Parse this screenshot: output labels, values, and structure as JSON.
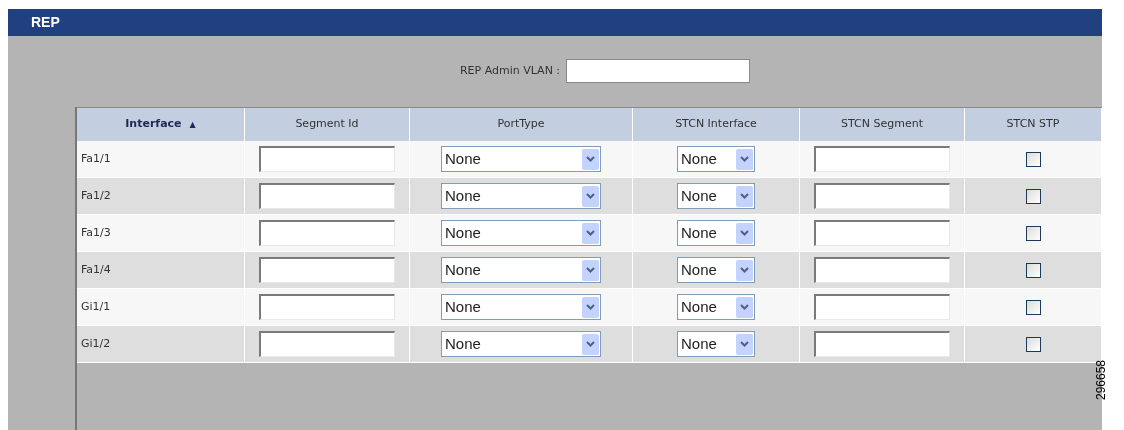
{
  "header": {
    "title": "REP"
  },
  "admin_vlan": {
    "label": "REP Admin VLAN :"
  },
  "table": {
    "columns": [
      {
        "label": "Interface",
        "sorted": true,
        "sort_icon": "▲"
      },
      {
        "label": "Segment Id",
        "sorted": false
      },
      {
        "label": "PortType",
        "sorted": false
      },
      {
        "label": "STCN Interface",
        "sorted": false
      },
      {
        "label": "STCN Segment",
        "sorted": false
      },
      {
        "label": "STCN STP",
        "sorted": false
      }
    ],
    "rows": [
      {
        "interface": "Fa1/1",
        "port_type": "None",
        "stcn_interface": "None",
        "stcn_stp": false
      },
      {
        "interface": "Fa1/2",
        "port_type": "None",
        "stcn_interface": "None",
        "stcn_stp": false
      },
      {
        "interface": "Fa1/3",
        "port_type": "None",
        "stcn_interface": "None",
        "stcn_stp": false
      },
      {
        "interface": "Fa1/4",
        "port_type": "None",
        "stcn_interface": "None",
        "stcn_stp": false
      },
      {
        "interface": "Gi1/1",
        "port_type": "None",
        "stcn_interface": "None",
        "stcn_stp": false
      },
      {
        "interface": "Gi1/2",
        "port_type": "None",
        "stcn_interface": "None",
        "stcn_stp": false
      }
    ]
  },
  "figure_number": "296658"
}
